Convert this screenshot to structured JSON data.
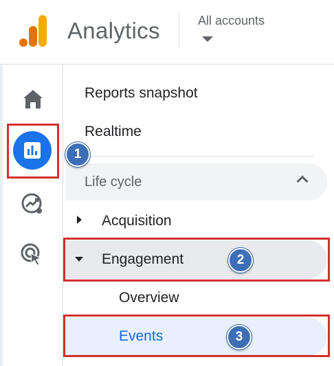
{
  "header": {
    "app_title": "Analytics",
    "accounts_label": "All accounts"
  },
  "rail": {
    "items": [
      {
        "icon": "home-icon",
        "active": false
      },
      {
        "icon": "reports-icon",
        "active": true
      },
      {
        "icon": "explore-icon",
        "active": false
      },
      {
        "icon": "advertising-icon",
        "active": false
      }
    ]
  },
  "nav": {
    "reports_snapshot": "Reports snapshot",
    "realtime": "Realtime",
    "section_title": "Life cycle",
    "acquisition": "Acquisition",
    "engagement": "Engagement",
    "overview": "Overview",
    "events": "Events"
  },
  "callouts": {
    "one": "1",
    "two": "2",
    "three": "3"
  },
  "colors": {
    "accent": "#1a73e8",
    "highlight_box": "#d32f2f",
    "callout": "#3c6fb6",
    "logo_orange": "#e37400",
    "logo_yellow": "#f9ab00"
  }
}
